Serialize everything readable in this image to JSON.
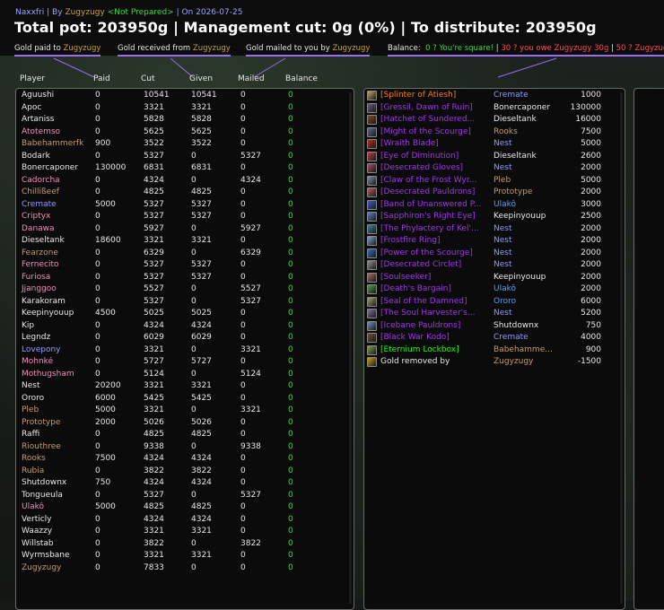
{
  "header": {
    "addon": "Naxxfri",
    "by_label": "| By",
    "master_looter": "Zugyzugy",
    "status": "<Not Prepared>",
    "date": "| On 2026-07-25",
    "totals": "Total pot: 203950g | Management cut: 0g (0%) | To distribute: 203950g"
  },
  "legend": {
    "paid_prefix": "Gold paid to",
    "paid_name": "Zugyzugy",
    "received_prefix": "Gold received from",
    "received_name": "Zugyzugy",
    "mailed_prefix": "Gold mailed to you by",
    "mailed_name": "Zugyzugy",
    "balance_label": "Balance:",
    "square": "0 ? You're square!",
    "owe": "30 ? you owe Zugyzugy 30g",
    "owes_you": "50 ? Zugyzug"
  },
  "columns": {
    "player": "Player",
    "paid": "Paid",
    "cut": "Cut",
    "given": "Given",
    "mailed": "Mailed",
    "balance": "Balance"
  },
  "colors": {
    "epic": "#a335ee",
    "legendary": "#ff8000",
    "uncommon": "#1eff00",
    "balance_zero": "#3cdc3c",
    "accent_purple": "#9b6cf0",
    "gold_name": "#c9a23a"
  },
  "players": [
    {
      "name": "Aguushi",
      "color": "#e8e8e8",
      "paid": "0",
      "cut": "10541",
      "given": "10541",
      "mailed": "0",
      "balance": "0"
    },
    {
      "name": "Apoc",
      "color": "#e8e8e8",
      "paid": "0",
      "cut": "3321",
      "given": "3321",
      "mailed": "0",
      "balance": "0"
    },
    {
      "name": "Artaniss",
      "color": "#e8e8e8",
      "paid": "0",
      "cut": "5828",
      "given": "5828",
      "mailed": "0",
      "balance": "0"
    },
    {
      "name": "Atotemso",
      "color": "#f58cba",
      "paid": "0",
      "cut": "5625",
      "given": "5625",
      "mailed": "0",
      "balance": "0"
    },
    {
      "name": "Babehammerfk",
      "color": "#c79c6e",
      "paid": "900",
      "cut": "3522",
      "given": "3522",
      "mailed": "0",
      "balance": "0"
    },
    {
      "name": "Bodark",
      "color": "#e8e8e8",
      "paid": "0",
      "cut": "5327",
      "given": "0",
      "mailed": "5327",
      "balance": "0"
    },
    {
      "name": "Bonercaponer",
      "color": "#e8e8e8",
      "paid": "130000",
      "cut": "6831",
      "given": "6831",
      "mailed": "0",
      "balance": "0"
    },
    {
      "name": "Cadorcha",
      "color": "#f58cba",
      "paid": "0",
      "cut": "4324",
      "given": "0",
      "mailed": "4324",
      "balance": "0"
    },
    {
      "name": "Chillißeef",
      "color": "#c79c6e",
      "paid": "0",
      "cut": "4825",
      "given": "4825",
      "mailed": "0",
      "balance": "0"
    },
    {
      "name": "Cremate",
      "color": "#8f9aff",
      "paid": "5000",
      "cut": "5327",
      "given": "5327",
      "mailed": "0",
      "balance": "0"
    },
    {
      "name": "Criptyx",
      "color": "#f58cba",
      "paid": "0",
      "cut": "5327",
      "given": "5327",
      "mailed": "0",
      "balance": "0"
    },
    {
      "name": "Danawa",
      "color": "#f58cba",
      "paid": "0",
      "cut": "5927",
      "given": "0",
      "mailed": "5927",
      "balance": "0"
    },
    {
      "name": "Dieseltank",
      "color": "#e8e8e8",
      "paid": "18600",
      "cut": "3321",
      "given": "3321",
      "mailed": "0",
      "balance": "0"
    },
    {
      "name": "Fearzone",
      "color": "#c79c6e",
      "paid": "0",
      "cut": "6329",
      "given": "0",
      "mailed": "6329",
      "balance": "0"
    },
    {
      "name": "Fernecito",
      "color": "#f58cba",
      "paid": "0",
      "cut": "5327",
      "given": "5327",
      "mailed": "0",
      "balance": "0"
    },
    {
      "name": "Furiosa",
      "color": "#f58cba",
      "paid": "0",
      "cut": "5327",
      "given": "5327",
      "mailed": "0",
      "balance": "0"
    },
    {
      "name": "Jjanggoo",
      "color": "#f58cba",
      "paid": "0",
      "cut": "5527",
      "given": "0",
      "mailed": "5527",
      "balance": "0"
    },
    {
      "name": "Karakoram",
      "color": "#e8e8e8",
      "paid": "0",
      "cut": "5327",
      "given": "0",
      "mailed": "5327",
      "balance": "0"
    },
    {
      "name": "Keepinyouup",
      "color": "#e8e8e8",
      "paid": "4500",
      "cut": "5025",
      "given": "5025",
      "mailed": "0",
      "balance": "0"
    },
    {
      "name": "Kip",
      "color": "#e8e8e8",
      "paid": "0",
      "cut": "4324",
      "given": "4324",
      "mailed": "0",
      "balance": "0"
    },
    {
      "name": "Legndz",
      "color": "#e8e8e8",
      "paid": "0",
      "cut": "6029",
      "given": "6029",
      "mailed": "0",
      "balance": "0"
    },
    {
      "name": "Lovepony",
      "color": "#8f9aff",
      "paid": "0",
      "cut": "3321",
      "given": "0",
      "mailed": "3321",
      "balance": "0"
    },
    {
      "name": "Mohnké",
      "color": "#f58cba",
      "paid": "0",
      "cut": "5727",
      "given": "5727",
      "mailed": "0",
      "balance": "0"
    },
    {
      "name": "Mothugsham",
      "color": "#f58cba",
      "paid": "0",
      "cut": "5124",
      "given": "0",
      "mailed": "5124",
      "balance": "0"
    },
    {
      "name": "Nest",
      "color": "#e8e8e8",
      "paid": "20200",
      "cut": "3321",
      "given": "3321",
      "mailed": "0",
      "balance": "0"
    },
    {
      "name": "Ororo",
      "color": "#e8e8e8",
      "paid": "6000",
      "cut": "5425",
      "given": "5425",
      "mailed": "0",
      "balance": "0"
    },
    {
      "name": "Pleb",
      "color": "#c79c6e",
      "paid": "5000",
      "cut": "3321",
      "given": "0",
      "mailed": "3321",
      "balance": "0"
    },
    {
      "name": "Prototype",
      "color": "#c79c6e",
      "paid": "2000",
      "cut": "5026",
      "given": "5026",
      "mailed": "0",
      "balance": "0"
    },
    {
      "name": "Raffi",
      "color": "#e8e8e8",
      "paid": "0",
      "cut": "4825",
      "given": "4825",
      "mailed": "0",
      "balance": "0"
    },
    {
      "name": "Riouthree",
      "color": "#c79c6e",
      "paid": "0",
      "cut": "9338",
      "given": "0",
      "mailed": "9338",
      "balance": "0"
    },
    {
      "name": "Rooks",
      "color": "#c79c6e",
      "paid": "7500",
      "cut": "4324",
      "given": "4324",
      "mailed": "0",
      "balance": "0"
    },
    {
      "name": "Rubia",
      "color": "#c79c6e",
      "paid": "0",
      "cut": "3822",
      "given": "3822",
      "mailed": "0",
      "balance": "0"
    },
    {
      "name": "Shutdownx",
      "color": "#e8e8e8",
      "paid": "750",
      "cut": "4324",
      "given": "4324",
      "mailed": "0",
      "balance": "0"
    },
    {
      "name": "Tongueula",
      "color": "#e8e8e8",
      "paid": "0",
      "cut": "5327",
      "given": "0",
      "mailed": "5327",
      "balance": "0"
    },
    {
      "name": "Ulakô",
      "color": "#f58cba",
      "paid": "5000",
      "cut": "4825",
      "given": "4825",
      "mailed": "0",
      "balance": "0"
    },
    {
      "name": "Verticly",
      "color": "#e8e8e8",
      "paid": "0",
      "cut": "4324",
      "given": "4324",
      "mailed": "0",
      "balance": "0"
    },
    {
      "name": "Waazzy",
      "color": "#e8e8e8",
      "paid": "0",
      "cut": "3321",
      "given": "3321",
      "mailed": "0",
      "balance": "0"
    },
    {
      "name": "Willstab",
      "color": "#e8e8e8",
      "paid": "0",
      "cut": "3822",
      "given": "0",
      "mailed": "3822",
      "balance": "0"
    },
    {
      "name": "Wyrmsbane",
      "color": "#e8e8e8",
      "paid": "0",
      "cut": "3321",
      "given": "3321",
      "mailed": "0",
      "balance": "0"
    },
    {
      "name": "Zugyzugy",
      "color": "#c79c6e",
      "paid": "0",
      "cut": "7833",
      "given": "0",
      "mailed": "0",
      "balance": "0"
    }
  ],
  "items": [
    {
      "name": "[Splinter of Atiesh]",
      "quality_color": "#ff8000",
      "icon": "splinter-icon",
      "icon_color": "#c9a060",
      "winner": "Cremate",
      "winner_color": "#8f9aff",
      "amount": "1000"
    },
    {
      "name": "[Gressil, Dawn of Ruin]",
      "quality_color": "#a335ee",
      "icon": "sword-icon",
      "icon_color": "#6a5a7a",
      "winner": "Bonercaponer",
      "winner_color": "#e8e8e8",
      "amount": "130000"
    },
    {
      "name": "[Hatchet of Sundered...",
      "quality_color": "#a335ee",
      "icon": "axe-icon",
      "icon_color": "#7a4a2a",
      "winner": "Dieseltank",
      "winner_color": "#e8e8e8",
      "amount": "16000"
    },
    {
      "name": "[Might of the Scourge]",
      "quality_color": "#a335ee",
      "icon": "shoulder-icon",
      "icon_color": "#5a6a8a",
      "winner": "Rooks",
      "winner_color": "#c79c6e",
      "amount": "7500"
    },
    {
      "name": "[Wraith Blade]",
      "quality_color": "#a335ee",
      "icon": "blade-icon",
      "icon_color": "#b03020",
      "winner": "Nest",
      "winner_color": "#8f9aff",
      "amount": "5000"
    },
    {
      "name": "[Eye of Diminution]",
      "quality_color": "#a335ee",
      "icon": "trinket-icon",
      "icon_color": "#b84040",
      "winner": "Dieseltank",
      "winner_color": "#e8e8e8",
      "amount": "2600"
    },
    {
      "name": "[Desecrated Gloves]",
      "quality_color": "#a335ee",
      "icon": "gloves-icon",
      "icon_color": "#a05060",
      "winner": "Nest",
      "winner_color": "#8f9aff",
      "amount": "2000"
    },
    {
      "name": "[Claw of the Frost Wyr...",
      "quality_color": "#a335ee",
      "icon": "claw-icon",
      "icon_color": "#8090a0",
      "winner": "Pleb",
      "winner_color": "#c79c6e",
      "amount": "5000"
    },
    {
      "name": "[Desecrated Pauldrons]",
      "quality_color": "#a335ee",
      "icon": "pauldrons-icon",
      "icon_color": "#b06060",
      "winner": "Prototype",
      "winner_color": "#c79c6e",
      "amount": "2000"
    },
    {
      "name": "[Band of Unanswered P...",
      "quality_color": "#a335ee",
      "icon": "ring-icon",
      "icon_color": "#4060c0",
      "winner": "Ulakô",
      "winner_color": "#4fa0ff",
      "amount": "3000"
    },
    {
      "name": "[Sapphiron's Right Eye]",
      "quality_color": "#a335ee",
      "icon": "eye-icon",
      "icon_color": "#6080c0",
      "winner": "Keepinyouup",
      "winner_color": "#e8e8e8",
      "amount": "2500"
    },
    {
      "name": "[The Phylactery of Kel'...",
      "quality_color": "#a335ee",
      "icon": "phylactery-icon",
      "icon_color": "#4080a0",
      "winner": "Nest",
      "winner_color": "#8f9aff",
      "amount": "2000"
    },
    {
      "name": "[Frostfire Ring]",
      "quality_color": "#a335ee",
      "icon": "ring-icon",
      "icon_color": "#80a0d0",
      "winner": "Nest",
      "winner_color": "#8f9aff",
      "amount": "2000"
    },
    {
      "name": "[Power of the Scourge]",
      "quality_color": "#a335ee",
      "icon": "shoulder-icon",
      "icon_color": "#3070c0",
      "winner": "Nest",
      "winner_color": "#8f9aff",
      "amount": "2000"
    },
    {
      "name": "[Desecrated Circlet]",
      "quality_color": "#a335ee",
      "icon": "helm-icon",
      "icon_color": "#909090",
      "winner": "Nest",
      "winner_color": "#8f9aff",
      "amount": "2000"
    },
    {
      "name": "[Soulseeker]",
      "quality_color": "#a335ee",
      "icon": "staff-icon",
      "icon_color": "#a07060",
      "winner": "Keepinyouup",
      "winner_color": "#e8e8e8",
      "amount": "2000"
    },
    {
      "name": "[Death's Bargain]",
      "quality_color": "#a335ee",
      "icon": "shield-icon",
      "icon_color": "#50a050",
      "winner": "Ulakô",
      "winner_color": "#4fa0ff",
      "amount": "2000"
    },
    {
      "name": "[Seal of the Damned]",
      "quality_color": "#a335ee",
      "icon": "seal-icon",
      "icon_color": "#a0a070",
      "winner": "Ororo",
      "winner_color": "#4fa0ff",
      "amount": "6000"
    },
    {
      "name": "[The Soul Harvester's...",
      "quality_color": "#a335ee",
      "icon": "bindings-icon",
      "icon_color": "#8070a0",
      "winner": "Nest",
      "winner_color": "#8f9aff",
      "amount": "5200"
    },
    {
      "name": "[Icebane Pauldrons]",
      "quality_color": "#a335ee",
      "icon": "pauldrons-icon",
      "icon_color": "#7090b0",
      "winner": "Shutdownx",
      "winner_color": "#e8e8e8",
      "amount": "750"
    },
    {
      "name": "[Black War Kodo]",
      "quality_color": "#a335ee",
      "icon": "kodo-icon",
      "icon_color": "#705030",
      "winner": "Cremate",
      "winner_color": "#8f9aff",
      "amount": "4000"
    },
    {
      "name": "[Eternium Lockbox]",
      "quality_color": "#1eff00",
      "icon": "lockbox-icon",
      "icon_color": "#80a040",
      "winner": "Babehamme...",
      "winner_color": "#c79c6e",
      "amount": "900"
    },
    {
      "name": "Gold removed by",
      "quality_color": "#e8e8e8",
      "icon": "gold-icon",
      "icon_color": "#c0a020",
      "winner": "Zugyzugy",
      "winner_color": "#c79c6e",
      "amount": "-1500"
    }
  ]
}
